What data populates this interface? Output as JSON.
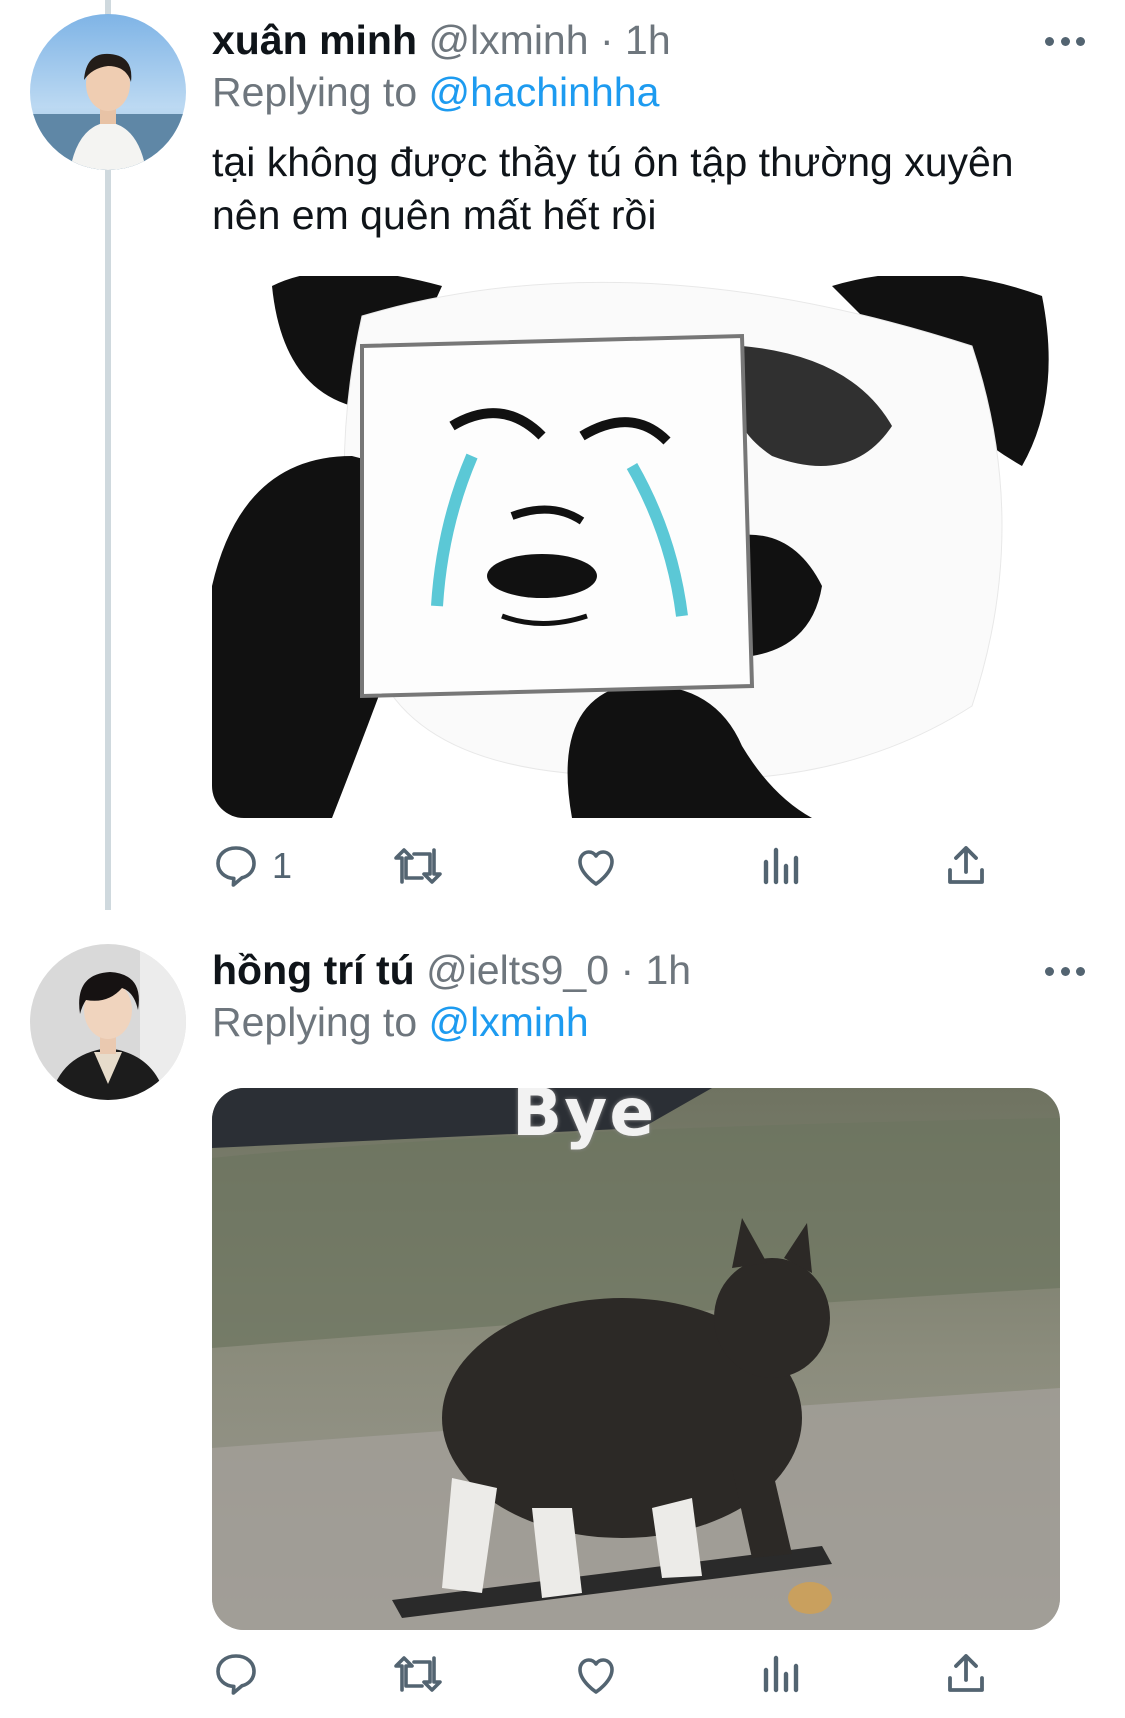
{
  "tweets": [
    {
      "display_name": "xuân minh",
      "handle": "@lxminh",
      "dot": "·",
      "time": "1h",
      "replying_label": "Replying to",
      "replying_to": "@hachinhha",
      "text_line1": "tại không được thầy tú ôn tập thường xuyên",
      "text_line2": "nên em quên mất hết rồi",
      "media": "panda-crying-meme",
      "reply_count": "1"
    },
    {
      "display_name": "hồng trí tú",
      "handle": "@ielts9_0",
      "dot": "·",
      "time": "1h",
      "replying_label": "Replying to",
      "replying_to": "@lxminh",
      "media_caption": "Bye",
      "media": "cat-on-skateboard-meme",
      "reply_count": ""
    }
  ],
  "icons": [
    "reply-icon",
    "retweet-icon",
    "like-icon",
    "views-icon",
    "share-icon",
    "more-icon"
  ],
  "colors": {
    "accent": "#1d9bf0",
    "secondary_text": "#6e767d",
    "thread_line": "#cfd9de"
  }
}
